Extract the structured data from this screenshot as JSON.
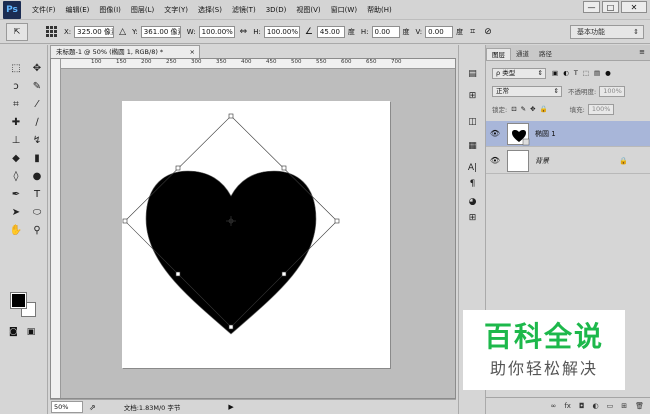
{
  "app": {
    "logo": "Ps"
  },
  "menu": [
    "文件(F)",
    "编辑(E)",
    "图像(I)",
    "图层(L)",
    "文字(Y)",
    "选择(S)",
    "滤镜(T)",
    "3D(D)",
    "视图(V)",
    "窗口(W)",
    "帮助(H)"
  ],
  "window_controls": {
    "minimize": "—",
    "restore": "□",
    "close": "✕"
  },
  "options": {
    "x_label": "X:",
    "x_value": "325.00 像素",
    "y_label": "Y:",
    "y_value": "361.00 像素",
    "w_label": "W:",
    "w_value": "100.00%",
    "h_label": "H:",
    "h_value": "100.00%",
    "angle_value": "45.00",
    "angle_unit": "度",
    "hskew_label": "H:",
    "hskew_value": "0.00",
    "hskew_unit": "度",
    "vskew_label": "V:",
    "vskew_value": "0.00",
    "vskew_unit": "度",
    "workspace": "基本功能"
  },
  "document": {
    "tab_title": "未标题-1 @ 50% (椭圆 1, RGB/8) *",
    "tab_close": "×",
    "ruler_ticks": [
      "100",
      "150",
      "200",
      "250",
      "300",
      "350",
      "400",
      "450",
      "500",
      "550",
      "600",
      "650",
      "700"
    ]
  },
  "status": {
    "zoom": "50%",
    "doc_info": "文档:1.83M/0 字节",
    "arrow": "▶"
  },
  "layers_panel": {
    "tabs": [
      "图层",
      "通道",
      "路径"
    ],
    "filter_label": "ρ 类型",
    "blend_mode": "正常",
    "opacity_label": "不透明度:",
    "opacity_value": "100%",
    "lock_label": "锁定:",
    "fill_label": "填充:",
    "fill_value": "100%",
    "layers": [
      {
        "name": "椭圆 1"
      },
      {
        "name": "背景"
      }
    ],
    "bottom_icons": [
      "∞",
      "fx",
      "◘",
      "◐",
      "▭",
      "⊞",
      "🗑"
    ]
  },
  "watermark": {
    "title": "百科全说",
    "subtitle": "助你轻松解决"
  },
  "colors": {
    "fg": "#000000",
    "bg": "#ffffff",
    "selection": "#a8b6d9",
    "watermark_green": "#1db84b"
  }
}
